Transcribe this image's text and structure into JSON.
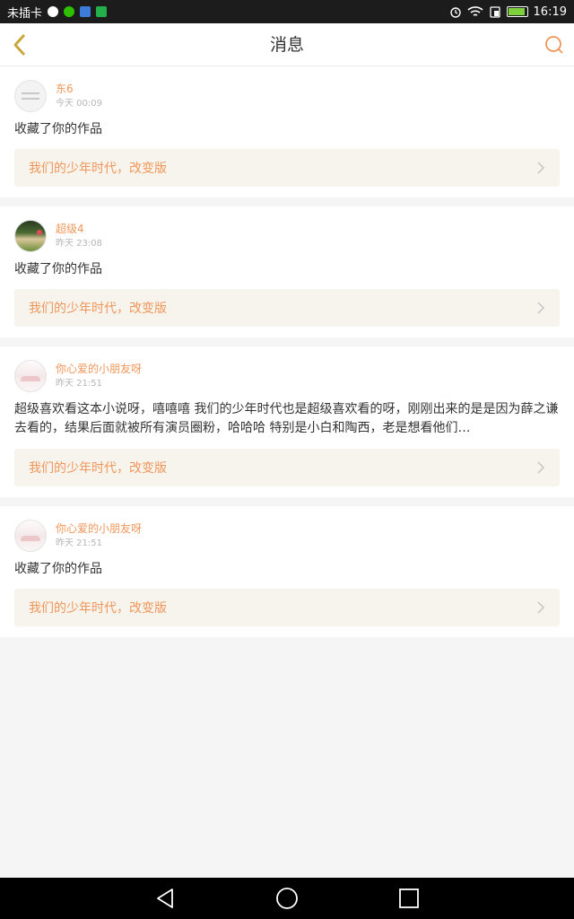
{
  "status_bar": {
    "carrier": "未插卡",
    "time": "16:19"
  },
  "header": {
    "title": "消息"
  },
  "messages": [
    {
      "username": "东6",
      "time": "今天 00:09",
      "text": "收藏了你的作品",
      "work_title": "我们的少年时代，改变版"
    },
    {
      "username": "超级4",
      "time": "昨天 23:08",
      "text": "收藏了你的作品",
      "work_title": "我们的少年时代，改变版"
    },
    {
      "username": "你心爱的小朋友呀",
      "time": "昨天 21:51",
      "text": "超级喜欢看这本小说呀，嘻嘻嘻 我们的少年时代也是超级喜欢看的呀，刚刚出来的是是因为薛之谦去看的，结果后面就被所有演员圈粉，哈哈哈 特别是小白和陶西，老是想看他们…",
      "work_title": "我们的少年时代，改变版"
    },
    {
      "username": "你心爱的小朋友呀",
      "time": "昨天 21:51",
      "text": "收藏了你的作品",
      "work_title": "我们的少年时代，改变版"
    }
  ],
  "colors": {
    "accent": "#f0965a",
    "link_bg": "#f6f4ec",
    "page_bg": "#f5f5f5"
  }
}
